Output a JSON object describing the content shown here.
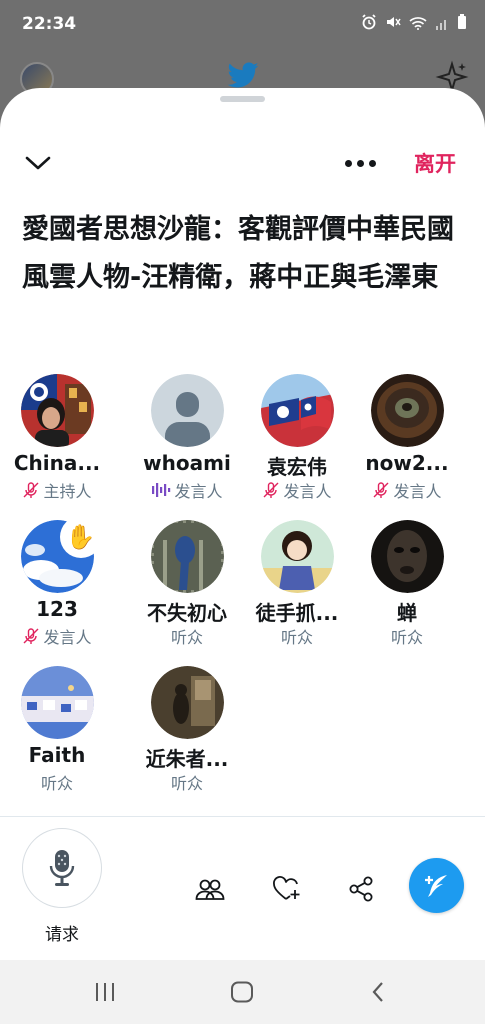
{
  "status_bar": {
    "time": "22:34"
  },
  "header": {
    "leave_label": "离开"
  },
  "space": {
    "title": "愛國者思想沙龍：客觀評價中華民國風雲人物-汪精衛，蔣中正與毛澤東"
  },
  "participants": [
    {
      "name": "China...",
      "role": "主持人",
      "mic": "muted",
      "avatar": "flag-woman"
    },
    {
      "name": "whoami",
      "role": "发言人",
      "mic": "speaking",
      "avatar": "default"
    },
    {
      "name": "袁宏伟",
      "role": "发言人",
      "mic": "muted",
      "avatar": "flag"
    },
    {
      "name": "now2...",
      "role": "发言人",
      "mic": "muted",
      "avatar": "bowl"
    },
    {
      "name": "123",
      "role": "发言人",
      "mic": "muted",
      "avatar": "sky",
      "hand_raised": true,
      "hand": "✋"
    },
    {
      "name": "不失初心",
      "role": "听众",
      "avatar": "parrot"
    },
    {
      "name": "徒手抓...",
      "role": "听众",
      "avatar": "anime"
    },
    {
      "name": "蝉",
      "role": "听众",
      "avatar": "dark-face"
    },
    {
      "name": "Faith",
      "role": "听众",
      "avatar": "town"
    },
    {
      "name": "近朱者...",
      "role": "听众",
      "avatar": "room"
    }
  ],
  "footer": {
    "request_label": "请求"
  },
  "colors": {
    "accent": "#1d9bf0",
    "leave": "#e0245e",
    "speaking": "#794bc4",
    "muted": "#e0245e",
    "secondary_text": "#657786"
  }
}
